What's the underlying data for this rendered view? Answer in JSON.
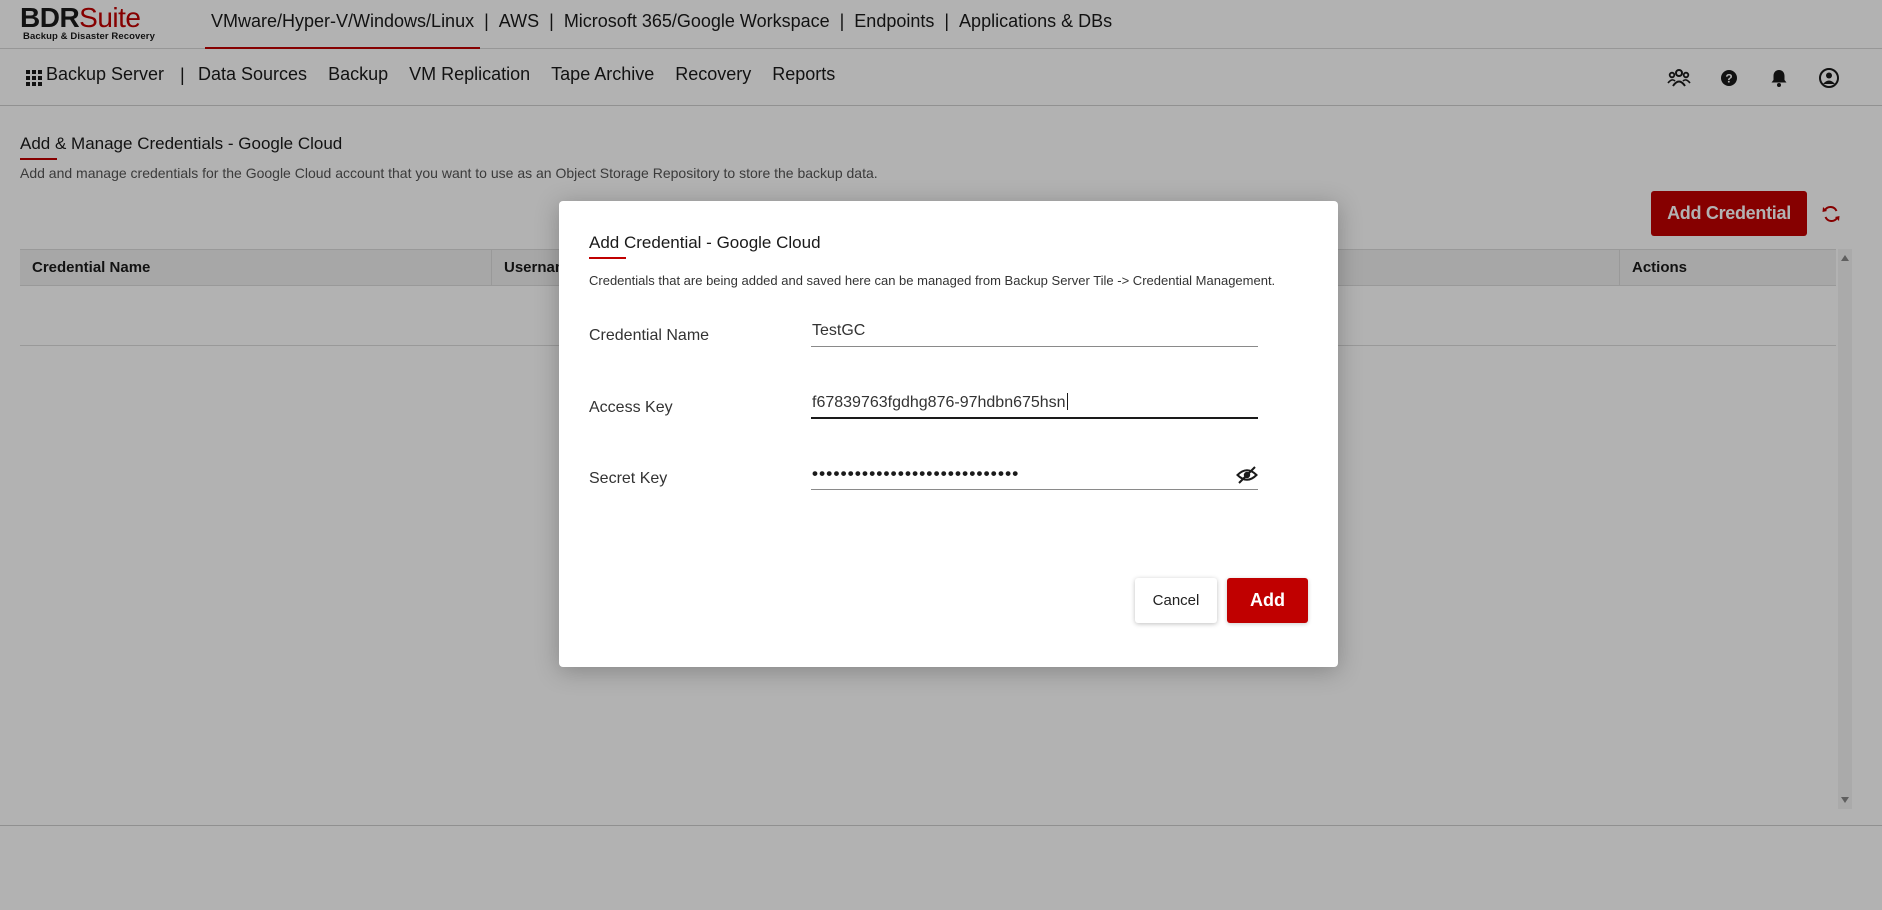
{
  "brand": {
    "name_part1": "BDR",
    "name_part2": "Suite",
    "tagline": "Backup & Disaster Recovery",
    "accent": "#c00000"
  },
  "product_nav": {
    "items": [
      "VMware/Hyper-V/Windows/Linux",
      "AWS",
      "Microsoft 365/Google Workspace",
      "Endpoints",
      "Applications & DBs"
    ],
    "separator": "|",
    "active_index": 0
  },
  "sub_nav": {
    "app_label": "Backup Server",
    "separator": "|",
    "menu": [
      "Data Sources",
      "Backup",
      "VM Replication",
      "Tape Archive",
      "Recovery",
      "Reports"
    ],
    "icons": [
      "users-icon",
      "help-icon",
      "bell-icon",
      "user-account-icon"
    ]
  },
  "page": {
    "title": "Add & Manage Credentials - Google Cloud",
    "description": "Add and manage credentials for the Google Cloud account that you want to use as an Object Storage Repository to store the backup data.",
    "add_button": "Add Credential",
    "table": {
      "columns": [
        "Credential Name",
        "Usernam",
        "Actions"
      ],
      "rows": []
    }
  },
  "modal": {
    "title": "Add Credential - Google Cloud",
    "description": "Credentials that are being added and saved here can be managed from Backup Server Tile -> Credential Management.",
    "fields": {
      "credential_name": {
        "label": "Credential Name",
        "value": "TestGC"
      },
      "access_key": {
        "label": "Access Key",
        "value": "f67839763fgdhg876-97hdbn675hsn"
      },
      "secret_key": {
        "label": "Secret Key",
        "value": "•••••••••••••••••••••••••••••"
      }
    },
    "cancel_label": "Cancel",
    "add_label": "Add"
  }
}
